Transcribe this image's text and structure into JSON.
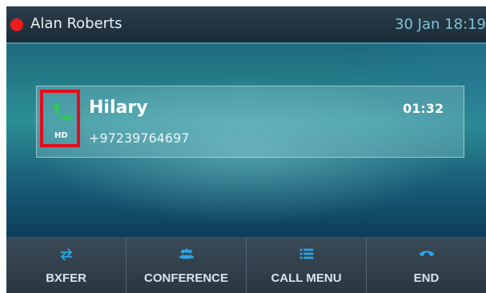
{
  "status": {
    "user_name": "Alan Roberts",
    "datetime": "30 Jan 18:19",
    "presence_color": "#ee1c1c"
  },
  "call": {
    "caller_name": "Hilary",
    "caller_number": "+97239764697",
    "timer": "01:32",
    "hd_badge": "HD",
    "icon": "phone-handset-icon",
    "icon_color": "#2fc85a"
  },
  "softkeys": [
    {
      "label": "BXFER",
      "icon": "transfer-arrows-icon"
    },
    {
      "label": "CONFERENCE",
      "icon": "conference-people-icon"
    },
    {
      "label": "CALL MENU",
      "icon": "menu-list-icon"
    },
    {
      "label": "END",
      "icon": "hangup-icon"
    }
  ],
  "colors": {
    "accent": "#4a8fb0",
    "highlight_border": "#e60b1b",
    "icon_blue": "#2aa6e8"
  }
}
